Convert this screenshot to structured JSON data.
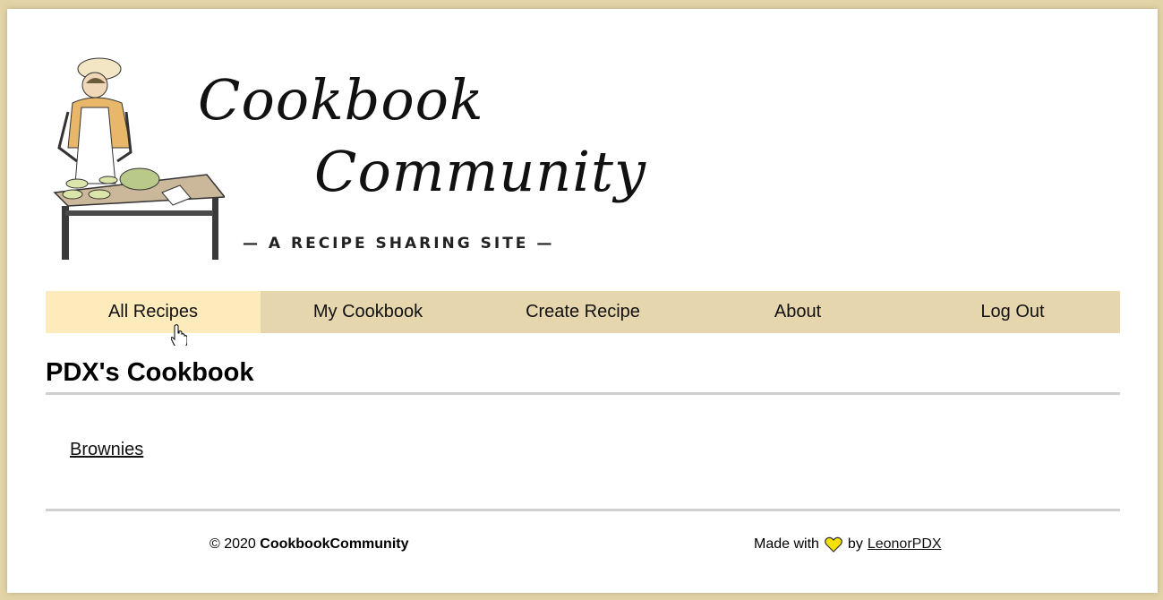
{
  "logo": {
    "title_line1": "Cookbook",
    "title_line2": "Community",
    "tagline": "— A RECIPE SHARING SITE —"
  },
  "nav": {
    "items": [
      {
        "label": "All Recipes",
        "active": true
      },
      {
        "label": "My Cookbook",
        "active": false
      },
      {
        "label": "Create Recipe",
        "active": false
      },
      {
        "label": "About",
        "active": false
      },
      {
        "label": "Log Out",
        "active": false
      }
    ]
  },
  "main": {
    "page_title": "PDX's Cookbook",
    "recipes": [
      "Brownies"
    ]
  },
  "footer": {
    "copyright_prefix": "© 2020",
    "site_name": "CookbookCommunity",
    "made_with": "Made with",
    "by": "by",
    "author": "LeonorPDX"
  },
  "colors": {
    "page_background": "#e3d4a8",
    "nav_background": "#e6d6ad",
    "nav_active": "#fdebbb",
    "heart": "#f5e000"
  }
}
